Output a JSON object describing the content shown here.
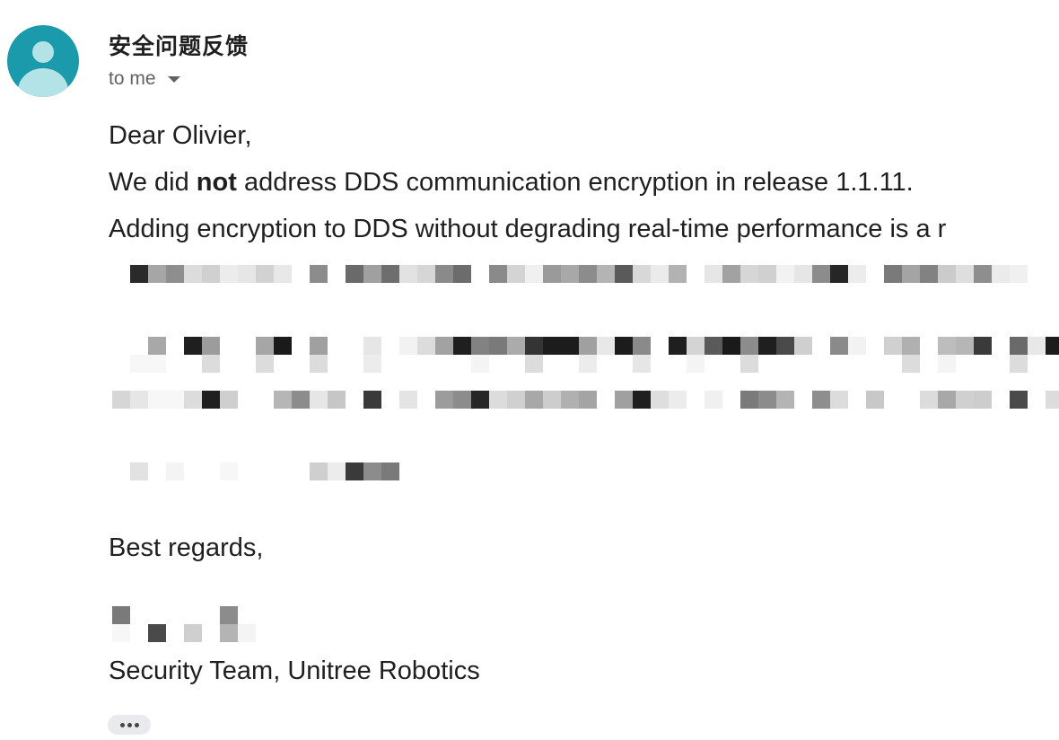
{
  "email": {
    "sender": "安全问题反馈",
    "recipient": "to me",
    "greeting": "Dear Olivier,",
    "body_line1_pre": "We did ",
    "body_line1_bold": "not",
    "body_line1_post": " address DDS communication encryption in release 1.1.11.",
    "body_line2": "Adding encryption to DDS without degrading real-time performance is a r",
    "closing": "Best regards,",
    "signature": "Security Team, Unitree Robotics"
  },
  "colors": {
    "avatar_bg": "#1a9aaa",
    "avatar_fg": "#b3e3e6"
  },
  "icons": {
    "avatar": "default-person-icon",
    "expand_recipients": "caret-down-icon",
    "show_trimmed": "ellipsis-icon"
  }
}
